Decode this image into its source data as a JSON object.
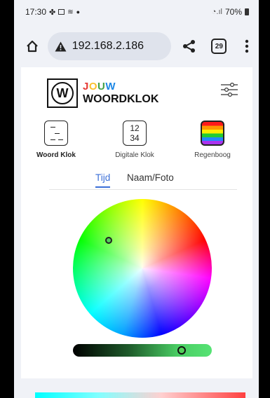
{
  "status_bar": {
    "time": "17:30",
    "battery": "70%"
  },
  "browser": {
    "url": "192.168.2.186",
    "tab_count": "29"
  },
  "app": {
    "logo_letter": "W",
    "logo_top": "JOUW",
    "logo_bottom": "WOORDKLOK",
    "logo_top_colors": [
      "#e53935",
      "#fbc02d",
      "#43a047",
      "#1e88e5"
    ],
    "modes": [
      {
        "label": "Woord Klok",
        "icon": "word-clock-icon",
        "active": true
      },
      {
        "label": "Digitale Klok",
        "icon": "digital-clock-icon",
        "digits": [
          "12",
          "34"
        ],
        "active": false
      },
      {
        "label": "Regenboog",
        "icon": "rainbow-icon",
        "active": false
      }
    ],
    "tabs": [
      {
        "label": "Tijd",
        "active": true
      },
      {
        "label": "Naam/Foto",
        "active": false
      }
    ],
    "accent_color": "#3b6fd8",
    "selected_color": "#52d05a",
    "brightness_level": 0.8
  }
}
